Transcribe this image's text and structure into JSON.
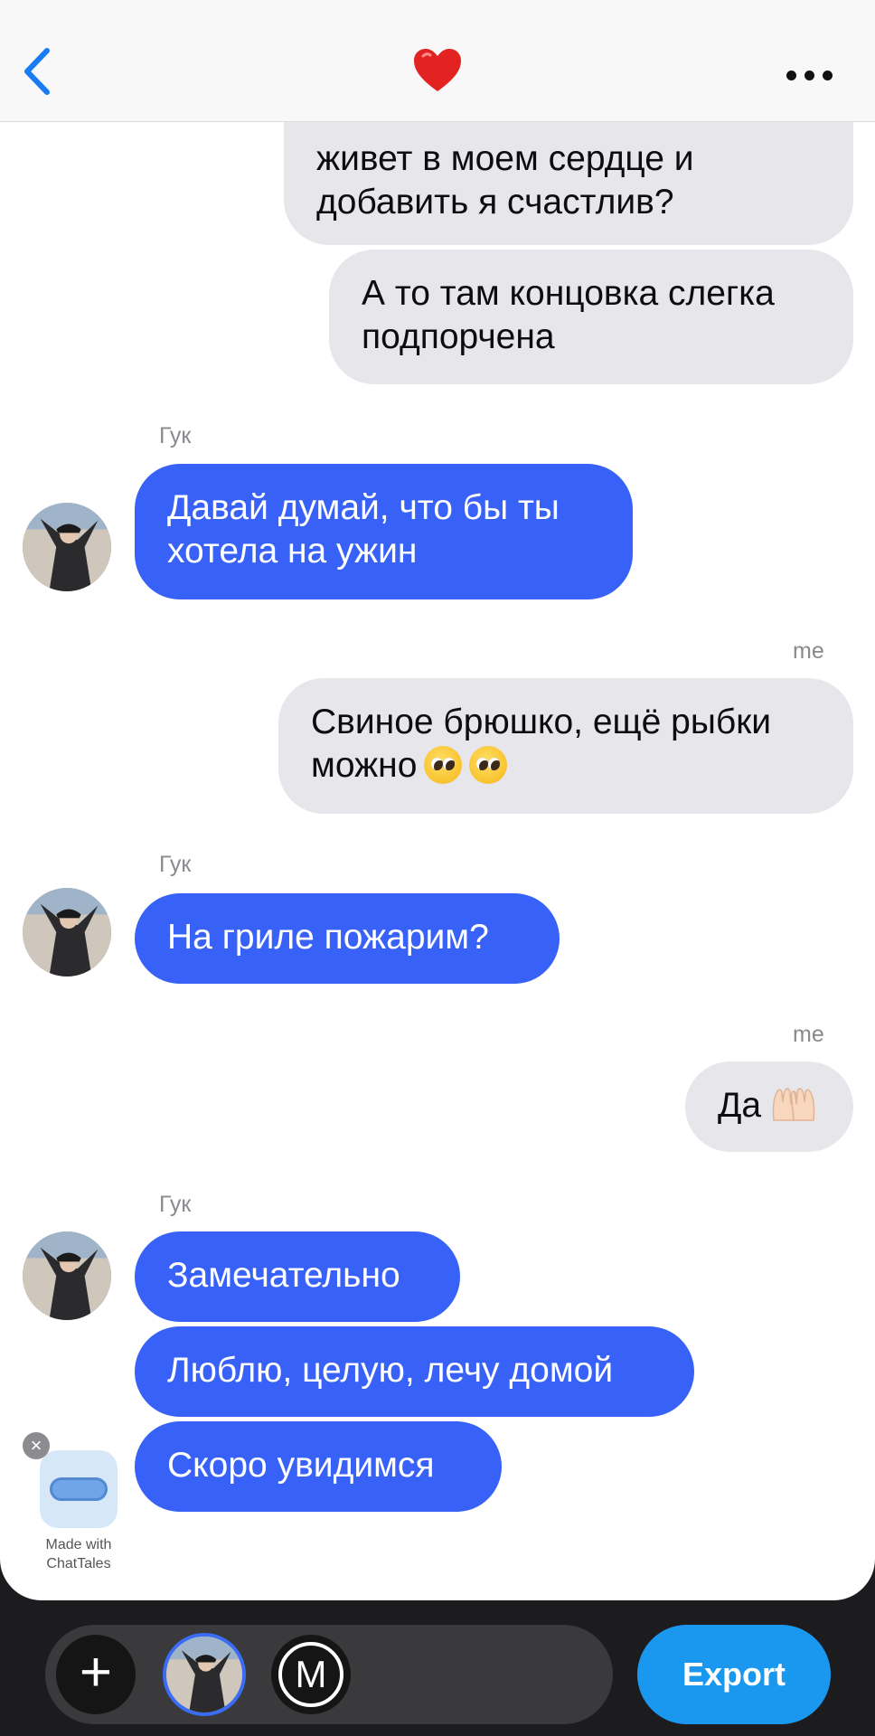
{
  "header": {
    "back_icon": "chevron-left-icon",
    "title_icon": "heart-icon",
    "title_icon_color": "#e32222",
    "menu_icon": "more-horizontal-icon",
    "accent": "#1a7cf4"
  },
  "messages": [
    {
      "side": "sent",
      "text_lines": [
        "живет в моем сердце и",
        "добавить я счастлив?"
      ]
    },
    {
      "side": "sent",
      "text_lines": [
        "А то там концовка слегка",
        "подпорчена"
      ]
    },
    {
      "side": "received",
      "sender": "Гук",
      "text_lines": [
        "Давай думай, что бы ты",
        "хотела на ужин"
      ]
    },
    {
      "side": "sent",
      "sender": "me",
      "text_lines": [
        "Свиное брюшко, ещё рыбки",
        "можно"
      ],
      "emoji": "pleading-face-icon x2"
    },
    {
      "side": "received",
      "sender": "Гук",
      "text_lines": [
        "На гриле пожарим?"
      ]
    },
    {
      "side": "sent",
      "sender": "me",
      "text_lines": [
        "Да"
      ],
      "emoji": "palms-up-together-icon"
    },
    {
      "side": "received",
      "sender": "Гук",
      "text_lines": [
        "Замечательно"
      ]
    },
    {
      "side": "received",
      "text_lines": [
        "Люблю, целую, лечу домой"
      ]
    },
    {
      "side": "received",
      "text_lines": [
        "Скоро увидимся"
      ]
    }
  ],
  "colors": {
    "sent_bubble": "#e7e6ea",
    "received_bubble": "#3862f7",
    "export_button": "#1a98f0"
  },
  "badge": {
    "line1": "Made with",
    "line2": "ChatTales"
  },
  "toolbar": {
    "plus_label": "+",
    "m_label": "M",
    "export_label": "Export"
  }
}
